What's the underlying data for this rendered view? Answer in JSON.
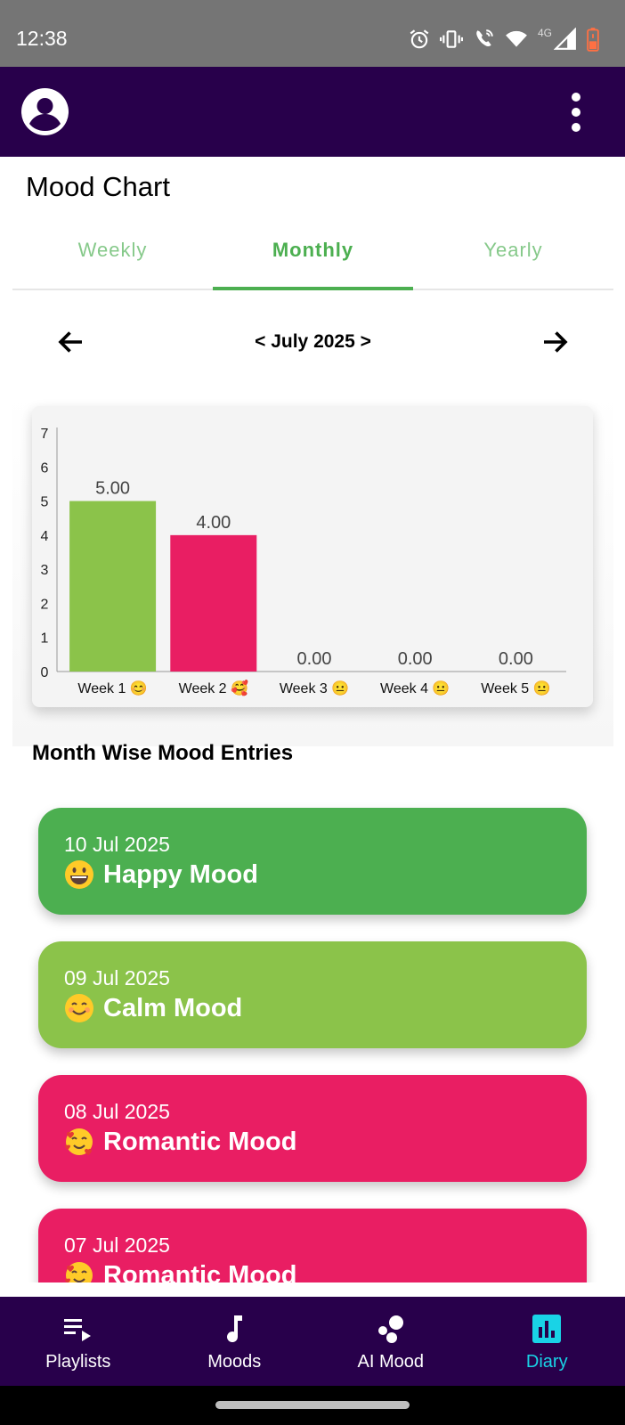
{
  "status_bar": {
    "time": "12:38",
    "network": "4G"
  },
  "header": {
    "title": "Mood Chart"
  },
  "tabs": [
    {
      "label": "Weekly",
      "active": false
    },
    {
      "label": "Monthly",
      "active": true
    },
    {
      "label": "Yearly",
      "active": false
    }
  ],
  "period": {
    "label": "< July 2025 >"
  },
  "chart_data": {
    "type": "bar",
    "categories": [
      "Week 1 😊",
      "Week 2 🥰",
      "Week 3 😐",
      "Week 4 😐",
      "Week 5 😐"
    ],
    "values": [
      5.0,
      4.0,
      0.0,
      0.0,
      0.0
    ],
    "value_labels": [
      "5.00",
      "4.00",
      "0.00",
      "0.00",
      "0.00"
    ],
    "bar_colors": [
      "#8bc34a",
      "#e91e63",
      "#8bc34a",
      "#8bc34a",
      "#8bc34a"
    ],
    "ylim": [
      0,
      7
    ],
    "yticks": [
      "0",
      "1",
      "2",
      "3",
      "4",
      "5",
      "6",
      "7"
    ],
    "grid": false,
    "legend": "none"
  },
  "section": {
    "title": "Month Wise Mood Entries"
  },
  "entries": [
    {
      "date": "10 Jul 2025",
      "mood": "Happy Mood",
      "emoji": "grinning-face",
      "color": "#4caf50"
    },
    {
      "date": "09 Jul 2025",
      "mood": "Calm Mood",
      "emoji": "smiling-face",
      "color": "#8bc34a"
    },
    {
      "date": "08 Jul 2025",
      "mood": "Romantic Mood",
      "emoji": "smiling-face-with-hearts",
      "color": "#e91e63"
    },
    {
      "date": "07 Jul 2025",
      "mood": "Romantic Mood",
      "emoji": "smiling-face-with-hearts",
      "color": "#e91e63"
    }
  ],
  "bottom_nav": [
    {
      "label": "Playlists",
      "icon": "playlist-icon",
      "active": false
    },
    {
      "label": "Moods",
      "icon": "music-note-icon",
      "active": false
    },
    {
      "label": "AI Mood",
      "icon": "bubbles-icon",
      "active": false
    },
    {
      "label": "Diary",
      "icon": "bar-chart-icon",
      "active": true
    }
  ],
  "colors": {
    "app_bar": "#28004b",
    "accent": "#4caf50",
    "nav_active": "#19d3e6"
  }
}
